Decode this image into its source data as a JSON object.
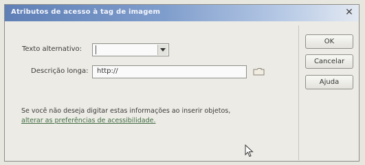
{
  "dialog": {
    "title": "Atributos de acesso à tag de imagem",
    "close_glyph": "✕"
  },
  "form": {
    "alt_label": "Texto alternativo:",
    "alt_value": "",
    "longdesc_label": "Descrição longa:",
    "longdesc_value": "http://"
  },
  "buttons": {
    "ok": "OK",
    "cancel": "Cancelar",
    "help": "Ajuda"
  },
  "info": {
    "text": "Se você não deseja digitar estas informações ao inserir objetos,",
    "link": "alterar as preferências de acessibilidade."
  }
}
